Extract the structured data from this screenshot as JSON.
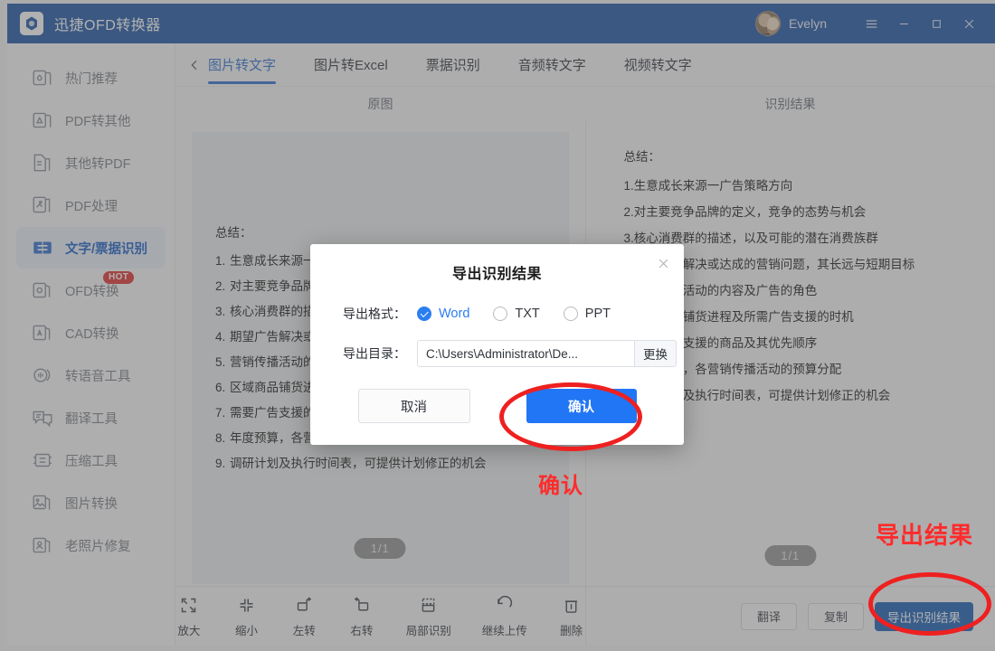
{
  "window": {
    "app_title": "迅捷OFD转换器",
    "username": "Evelyn",
    "logo_icon": "hexagon-logo-icon",
    "avatar_icon": "user-avatar",
    "menu_icon": "hamburger-menu-icon",
    "minimize_icon": "minimize-icon",
    "maximize_icon": "maximize-icon",
    "close_icon": "close-icon",
    "accent_color": "#1d55a5"
  },
  "sidebar": {
    "items": [
      {
        "label": "热门推荐",
        "icon": "fire-stack-icon",
        "active": false,
        "badge": null
      },
      {
        "label": "PDF转其他",
        "icon": "pdf-out-icon",
        "active": false,
        "badge": null
      },
      {
        "label": "其他转PDF",
        "icon": "doc-to-pdf-icon",
        "active": false,
        "badge": null
      },
      {
        "label": "PDF处理",
        "icon": "pdf-tools-icon",
        "active": false,
        "badge": null
      },
      {
        "label": "文字/票据识别",
        "icon": "ocr-card-icon",
        "active": true,
        "badge": null
      },
      {
        "label": "OFD转换",
        "icon": "ofd-icon",
        "active": false,
        "badge": "HOT"
      },
      {
        "label": "CAD转换",
        "icon": "cad-icon",
        "active": false,
        "badge": null
      },
      {
        "label": "转语音工具",
        "icon": "speech-icon",
        "active": false,
        "badge": null
      },
      {
        "label": "翻译工具",
        "icon": "translate-icon",
        "active": false,
        "badge": null
      },
      {
        "label": "压缩工具",
        "icon": "compress-icon",
        "active": false,
        "badge": null
      },
      {
        "label": "图片转换",
        "icon": "image-convert-icon",
        "active": false,
        "badge": null
      },
      {
        "label": "老照片修复",
        "icon": "photo-restore-icon",
        "active": false,
        "badge": null
      }
    ],
    "active_color": "#1a5fc8",
    "badge_color": "#e03131"
  },
  "main": {
    "back_icon": "chevron-left-icon",
    "tabs": [
      {
        "label": "图片转文字",
        "active": true
      },
      {
        "label": "图片转Excel",
        "active": false
      },
      {
        "label": "票据识别",
        "active": false
      },
      {
        "label": "音频转文字",
        "active": false
      },
      {
        "label": "视频转文字",
        "active": false
      }
    ],
    "tab_active_color": "#2f6fd0",
    "panel_headers": {
      "left": "原图",
      "right": "识别结果"
    },
    "page_badge_left": "1/1",
    "page_badge_right": "1/1"
  },
  "document": {
    "summary_label": "总结：",
    "left_lines": [
      {
        "num": "1.",
        "text": "生意成长来源一广告策略方向"
      },
      {
        "num": "2.",
        "text": "对主要竞争品牌的定义，竞争的态势与机会"
      },
      {
        "num": "3.",
        "text": "核心消费群的描述，以及可能的潜在消费族群"
      },
      {
        "num": "4.",
        "text": "期望广告解决或达成的营销问题，其长远与短期目标"
      },
      {
        "num": "5.",
        "text": "营销传播活动的内容及广告的角色"
      },
      {
        "num": "6.",
        "text": "区域商品铺货进程及所需广告支援的时机"
      },
      {
        "num": "7.",
        "text": "需要广告支援的商品及其优先顺序"
      },
      {
        "num": "8.",
        "text": "年度预算，各营销传播活动的预算分配"
      },
      {
        "num": "9.",
        "text": "调研计划及执行时间表，可提供计划修正的机会"
      }
    ],
    "right_lines": [
      {
        "num": "1.",
        "text": "生意成长来源一广告策略方向"
      },
      {
        "num": "2.",
        "text": "对主要竞争品牌的定义，竞争的态势与机会"
      },
      {
        "num": "3.",
        "text": "核心消费群的描述，以及可能的潜在消费族群"
      },
      {
        "num": "4.",
        "text": "期望广告解决或达成的营销问题，其长远与短期目标"
      },
      {
        "num": "5.",
        "text": "营销传播活动的内容及广告的角色"
      },
      {
        "num": "6.",
        "text": "区域商品铺货进程及所需广告支援的时机"
      },
      {
        "num": "7.",
        "text": "需要广告支援的商品及其优先顺序"
      },
      {
        "num": "8.",
        "text": "年度预算，各营销传播活动的预算分配"
      },
      {
        "num": "9.",
        "text": "调研计划及执行时间表，可提供计划修正的机会"
      }
    ]
  },
  "toolbar": {
    "tools": [
      {
        "label": "放大",
        "icon": "zoom-in-icon"
      },
      {
        "label": "缩小",
        "icon": "zoom-out-icon"
      },
      {
        "label": "左转",
        "icon": "rotate-left-icon"
      },
      {
        "label": "右转",
        "icon": "rotate-right-icon"
      },
      {
        "label": "局部识别",
        "icon": "crop-recognize-icon"
      },
      {
        "label": "继续上传",
        "icon": "undo-upload-icon"
      },
      {
        "label": "删除",
        "icon": "trash-icon"
      }
    ]
  },
  "actions": {
    "translate": "翻译",
    "copy": "复制",
    "export": "导出识别结果",
    "export_color": "#1a5fb4"
  },
  "modal": {
    "title": "导出识别结果",
    "close_icon": "close-icon",
    "format_label": "导出格式：",
    "formats": [
      {
        "label": "Word",
        "selected": true
      },
      {
        "label": "TXT",
        "selected": false
      },
      {
        "label": "PPT",
        "selected": false
      }
    ],
    "dir_label": "导出目录：",
    "dir_value": "C:\\Users\\Administrator\\De...",
    "dir_placeholder": "C:\\Users\\Administrator\\De...",
    "change_button": "更换",
    "cancel_button": "取消",
    "confirm_button": "确认",
    "confirm_color": "#2176f5"
  },
  "annotations": {
    "confirm_note": "确认",
    "export_note": "导出结果",
    "color": "#ff2b2b"
  }
}
